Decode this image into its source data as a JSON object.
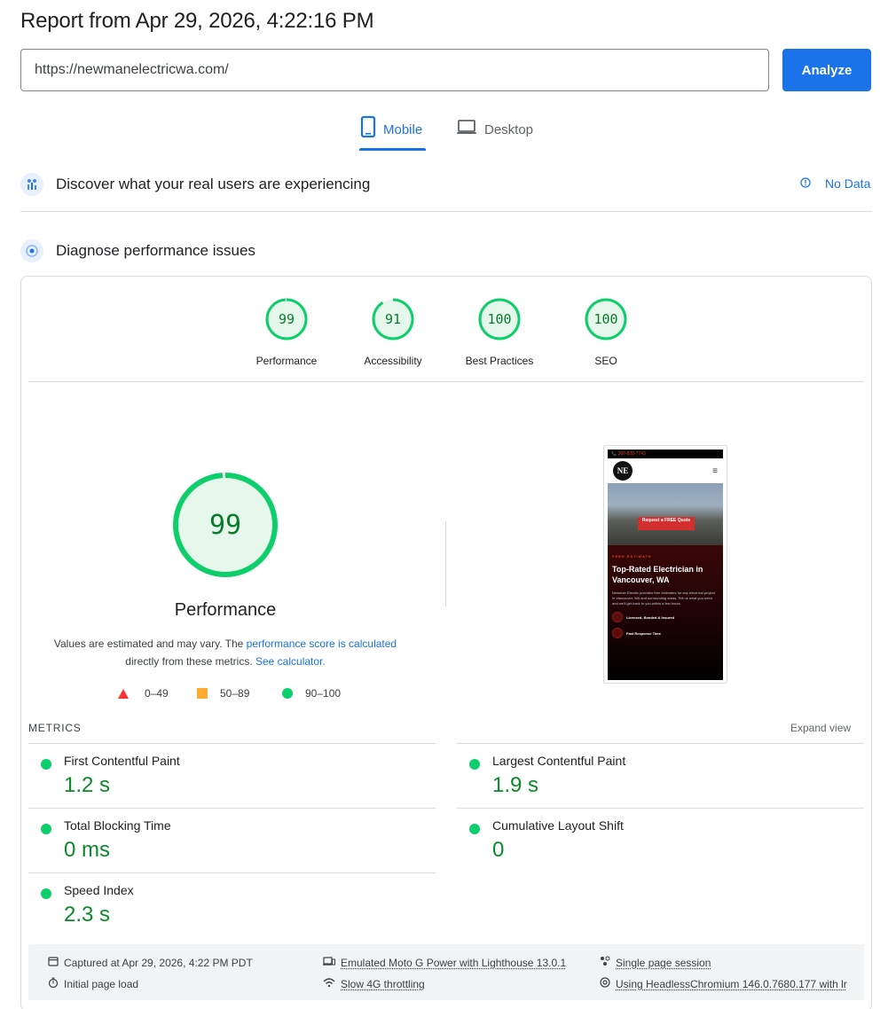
{
  "report": {
    "title": "Report from Apr 29, 2026, 4:22:16 PM",
    "url_value": "https://newmanelectricwa.com/",
    "analyze_label": "Analyze"
  },
  "tabs": [
    {
      "label": "Mobile",
      "active": true
    },
    {
      "label": "Desktop",
      "active": false
    }
  ],
  "sections": {
    "discover_title": "Discover what your real users are experiencing",
    "no_data": "No Data",
    "diagnose_title": "Diagnose performance issues"
  },
  "scores": [
    {
      "label": "Performance",
      "value": "99",
      "fraction": 0.99
    },
    {
      "label": "Accessibility",
      "value": "91",
      "fraction": 0.91
    },
    {
      "label": "Best Practices",
      "value": "100",
      "fraction": 1.0
    },
    {
      "label": "SEO",
      "value": "100",
      "fraction": 1.0
    }
  ],
  "performance": {
    "score": "99",
    "fraction": 0.99,
    "label": "Performance",
    "desc_prefix": "Values are estimated and may vary. The ",
    "desc_link1": "performance score is calculated",
    "desc_middle": "directly from these metrics.",
    "desc_link2": "See calculator."
  },
  "legend": {
    "poor": "0–49",
    "average": "50–89",
    "good": "90–100"
  },
  "screenshot": {
    "topbar": "📞 360-828-7743",
    "logo": "NE",
    "cta": "Request a FREE Quote",
    "kicker": "FREE ESTIMATE",
    "heading": "Top-Rated Electrician in Vancouver, WA",
    "copy": "Newman Electric provides free estimates for any electrical project in Vancouver, WA and surrounding areas. Tell us what you need and we'll get back to you within a few hours.",
    "feature1": "Licensed, Bonded & Insured",
    "feature2": "Fast Response Time"
  },
  "metrics": {
    "heading": "METRICS",
    "expand": "Expand view",
    "items": [
      {
        "name": "First Contentful Paint",
        "value": "1.2 s"
      },
      {
        "name": "Largest Contentful Paint",
        "value": "1.9 s"
      },
      {
        "name": "Total Blocking Time",
        "value": "0 ms"
      },
      {
        "name": "Cumulative Layout Shift",
        "value": "0"
      },
      {
        "name": "Speed Index",
        "value": "2.3 s"
      }
    ]
  },
  "footer": {
    "captured": "Captured at Apr 29, 2026, 4:22 PM PDT",
    "initial_load": "Initial page load",
    "device": "Emulated Moto G Power with Lighthouse 13.0.1",
    "throttling": "Slow 4G throttling",
    "session": "Single page session",
    "browser": "Using HeadlessChromium 146.0.7680.177 with lr"
  },
  "colors": {
    "accent": "#1a73e8",
    "pass": "#0cce6b",
    "pass_text": "#0a8a2a",
    "average": "#ffaa33",
    "fail": "#ff3333"
  }
}
